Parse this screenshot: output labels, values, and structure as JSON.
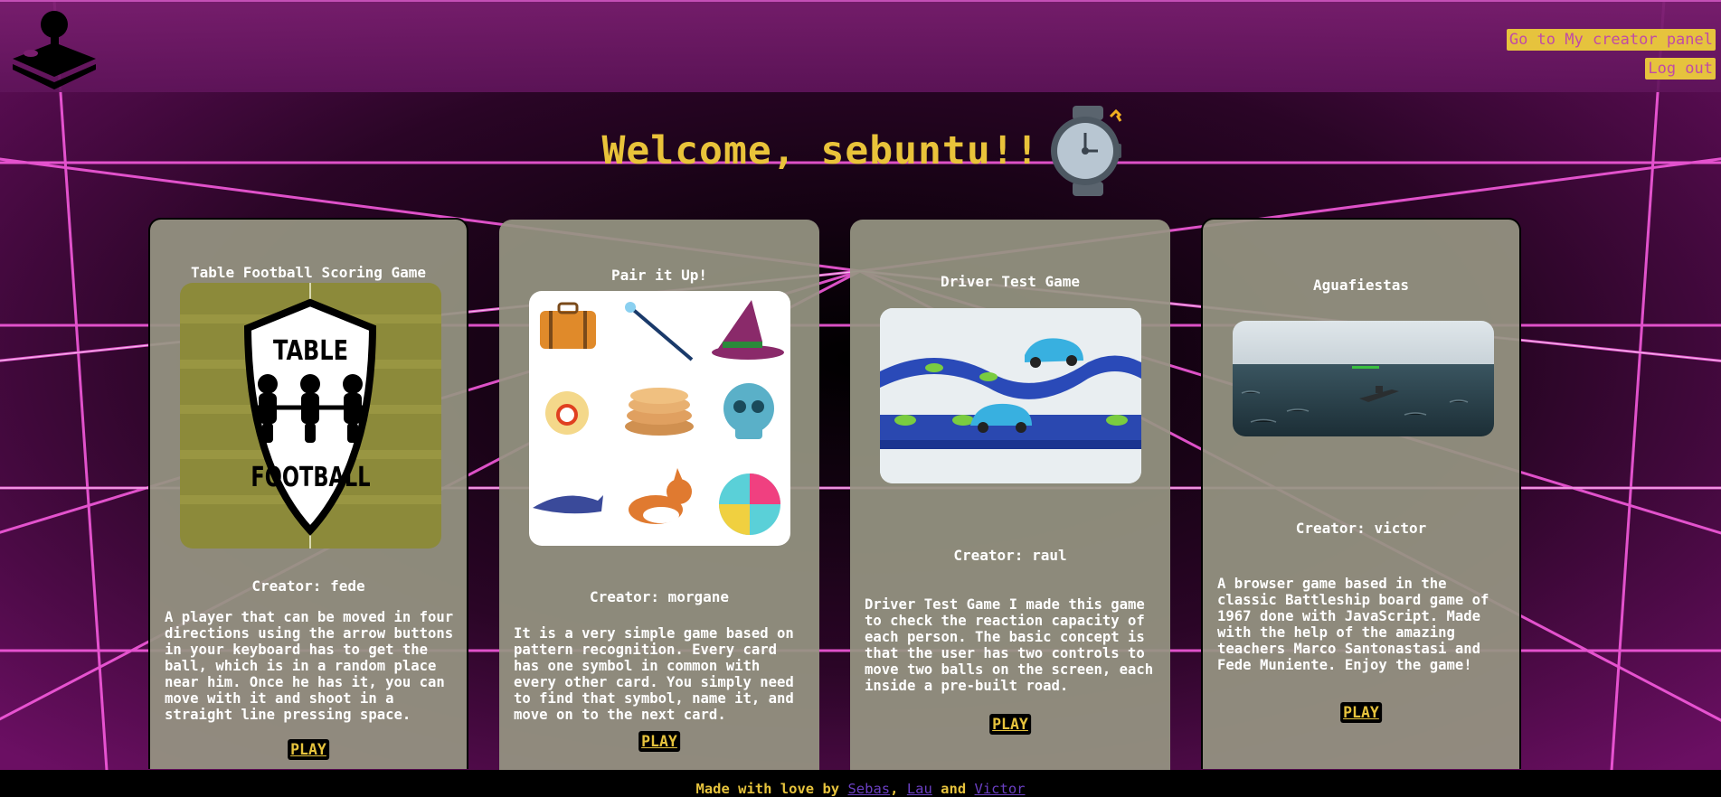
{
  "header": {
    "creator_panel_label": "Go to My creator panel",
    "logout_label": "Log out"
  },
  "welcome": {
    "title": "Welcome, sebuntu!!"
  },
  "cards": [
    {
      "title": "Table Football Scoring Game",
      "image_label_top": "TABLE",
      "image_label_bottom": "FOOTBALL",
      "creator": "Creator: fede",
      "description": "A player that can be moved in four directions using the arrow buttons in your keyboard has to get the ball, which is in a random place near him. Once he has it, you can move with it and shoot in a straight line pressing space.",
      "play_label": "PLAY"
    },
    {
      "title": "Pair it Up!",
      "creator": "Creator: morgane",
      "description": "It is a very simple game based on pattern recognition. Every card has one symbol in common with every other card. You simply need to find that symbol, name it, and move on to the next card.",
      "play_label": "PLAY"
    },
    {
      "title": "Driver Test Game",
      "creator": "Creator: raul",
      "description": "Driver Test Game I made this game to check the reaction capacity of each person. The basic concept is that the user has two controls to move two balls on the screen, each inside a pre-built road.",
      "play_label": "PLAY"
    },
    {
      "title": "Aguafiestas",
      "creator": "Creator: victor",
      "description": "A browser game based in the classic Battleship board game of 1967 done with JavaScript. Made with the help of the amazing teachers Marco Santonastasi and Fede Muniente. Enjoy the game!",
      "play_label": "PLAY"
    }
  ],
  "footer": {
    "prefix": "Made with love by",
    "sep1": ",",
    "sep2": "and",
    "authors": [
      "Sebas",
      "Lau",
      "Victor"
    ]
  },
  "colors": {
    "accent_yellow": "#e6c33d",
    "header_purple": "#7a1e6e",
    "card_bg": "#96947f",
    "link_purple": "#6a3fc2"
  }
}
